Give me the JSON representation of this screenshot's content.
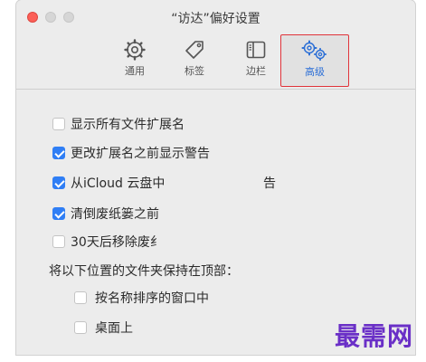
{
  "window": {
    "title": "“访达”偏好设置"
  },
  "toolbar": {
    "tabs": [
      {
        "label": "通用"
      },
      {
        "label": "标签"
      },
      {
        "label": "边栏"
      },
      {
        "label": "高级"
      }
    ],
    "active_tab": "高级"
  },
  "options": {
    "show_extensions": {
      "label": "显示所有文件扩展名",
      "checked": false
    },
    "warn_extension_change": {
      "label": "更改扩展名之前显示警告",
      "checked": true
    },
    "icloud_warn": {
      "label": "从iCloud 云盘中",
      "label_tail": "告",
      "checked": true
    },
    "empty_trash_warn": {
      "label": "清倒废纸篓之前",
      "checked": true
    },
    "remove_trash_30": {
      "label": "30天后移除废纟",
      "checked": false
    },
    "folders_on_top_heading": "将以下位置的文件夹保持在顶部：",
    "windows_sorted_by_name": {
      "label": "按名称排序的窗口中",
      "checked": false
    },
    "on_desktop": {
      "label": "桌面上",
      "checked": false
    }
  },
  "watermark": "最需网",
  "colors": {
    "accent": "#2f7ef5",
    "active_border": "#e0333a",
    "watermark": "#6a2fc7"
  }
}
